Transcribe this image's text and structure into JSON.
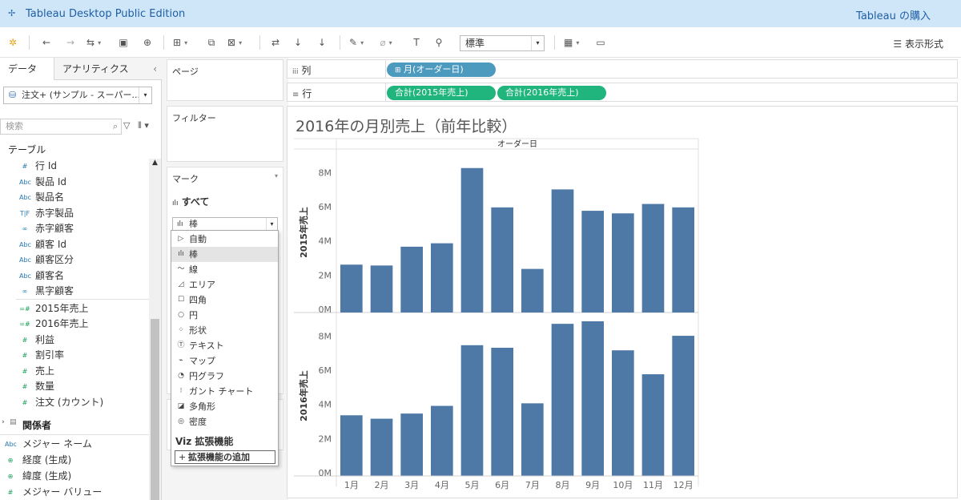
{
  "app": {
    "title": "Tableau Desktop Public Edition",
    "buy": "Tableau の購入"
  },
  "toolbar": {
    "standard": "標準",
    "display_format": "表示形式"
  },
  "data_pane": {
    "tabs": [
      "データ",
      "アナリティクス"
    ],
    "datasource": "注文+ (サンプル - スーパー...",
    "search_placeholder": "検索",
    "tables_header": "テーブル",
    "fields": [
      {
        "icon": "#",
        "label": "行 Id",
        "color": "blue"
      },
      {
        "icon": "Abc",
        "label": "製品 Id",
        "color": "blue"
      },
      {
        "icon": "Abc",
        "label": "製品名",
        "color": "blue"
      },
      {
        "icon": "T|F",
        "label": "赤字製品",
        "color": "blue"
      },
      {
        "icon": "∞",
        "label": "赤字顧客",
        "color": "blue"
      },
      {
        "icon": "Abc",
        "label": "顧客 Id",
        "color": "blue"
      },
      {
        "icon": "Abc",
        "label": "顧客区分",
        "color": "blue"
      },
      {
        "icon": "Abc",
        "label": "顧客名",
        "color": "blue"
      },
      {
        "icon": "∞",
        "label": "黒字顧客",
        "color": "blue"
      },
      {
        "icon": "=#",
        "label": "2015年売上",
        "color": "green"
      },
      {
        "icon": "=#",
        "label": "2016年売上",
        "color": "green"
      },
      {
        "icon": "#",
        "label": "利益",
        "color": "green"
      },
      {
        "icon": "#",
        "label": "割引率",
        "color": "green"
      },
      {
        "icon": "#",
        "label": "売上",
        "color": "green"
      },
      {
        "icon": "#",
        "label": "数量",
        "color": "green"
      },
      {
        "icon": "#",
        "label": "注文 (カウント)",
        "color": "green"
      }
    ],
    "relations_header": "関係者",
    "extra_fields": [
      {
        "icon": "Abc",
        "label": "メジャー ネーム"
      },
      {
        "icon": "⊕",
        "label": "経度 (生成)"
      },
      {
        "icon": "⊕",
        "label": "緯度 (生成)"
      },
      {
        "icon": "#",
        "label": "メジャー バリュー"
      }
    ]
  },
  "shelves": {
    "pages": "ページ",
    "filters": "フィルター",
    "marks": "マーク",
    "marks_all": "すべて",
    "mark_type": "棒",
    "columns_label": "列",
    "rows_label": "行",
    "columns_pills": [
      "月(オーダー日)"
    ],
    "rows_pills": [
      "合計(2015年売上)",
      "合計(2016年売上)"
    ]
  },
  "mark_menu": {
    "items": [
      "自動",
      "棒",
      "線",
      "エリア",
      "四角",
      "円",
      "形状",
      "テキスト",
      "マップ",
      "円グラフ",
      "ガント チャート",
      "多角形",
      "密度"
    ],
    "icons": [
      "▷",
      "ılı",
      "〜",
      "◿",
      "☐",
      "○",
      "⁘",
      "Ⓣ",
      "⌁",
      "◔",
      "⁝",
      "◪",
      "◎"
    ],
    "selected": "棒",
    "viz_ext_header": "Viz 拡張機能",
    "add_ext": "拡張機能の追加"
  },
  "viz": {
    "title": "2016年の月別売上（前年比較）"
  },
  "chart_data": {
    "type": "bar",
    "title": "2016年の月別売上（前年比較）",
    "column_header": "オーダー日",
    "categories": [
      "1月",
      "2月",
      "3月",
      "4月",
      "5月",
      "6月",
      "7月",
      "8月",
      "9月",
      "10月",
      "11月",
      "12月"
    ],
    "ylim": [
      0,
      9
    ],
    "yticks": [
      "0M",
      "2M",
      "4M",
      "6M",
      "8M"
    ],
    "series": [
      {
        "name": "2015年売上",
        "values": [
          2.8,
          2.75,
          3.85,
          4.05,
          8.45,
          6.15,
          2.55,
          7.2,
          5.95,
          5.8,
          6.35,
          6.15
        ]
      },
      {
        "name": "2016年売上",
        "values": [
          3.55,
          3.35,
          3.65,
          4.1,
          7.65,
          7.5,
          4.25,
          8.9,
          9.05,
          7.35,
          5.95,
          8.2
        ]
      }
    ],
    "bar_color": "#4e79a7"
  }
}
